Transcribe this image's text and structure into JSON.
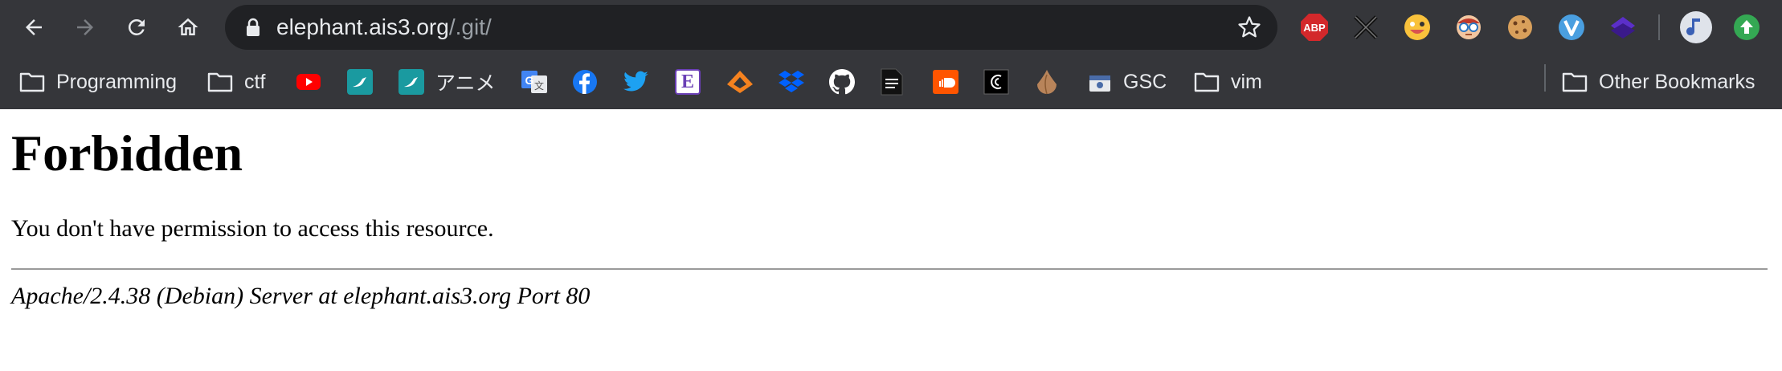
{
  "browser": {
    "url_host": "elephant.ais3.org",
    "url_path": "/.git/",
    "extensions": [
      {
        "icon": "adblock-plus-icon",
        "label": "ABP",
        "color": "#d3282b"
      },
      {
        "icon": "crossed-tools-icon"
      },
      {
        "icon": "grinning-emoji-icon"
      },
      {
        "icon": "glasses-face-icon"
      },
      {
        "icon": "cookie-icon"
      },
      {
        "icon": "vimium-icon",
        "color": "#4a9fe0"
      },
      {
        "icon": "purple-layers-icon",
        "color": "#5b2fc9"
      },
      {
        "icon": "profile-avatar-icon"
      },
      {
        "icon": "update-arrow-icon",
        "color": "#34a853"
      }
    ]
  },
  "bookmarks": {
    "items": [
      {
        "label": "Programming",
        "icon": "folder-icon"
      },
      {
        "label": "ctf",
        "icon": "folder-icon"
      },
      {
        "label": "",
        "icon": "youtube-icon",
        "color": "#ff0000"
      },
      {
        "label": "",
        "icon": "teal-bird-icon",
        "color": "#1a9aa0"
      },
      {
        "label": "アニメ",
        "icon": "teal-bird-icon",
        "color": "#1a9aa0"
      },
      {
        "label": "",
        "icon": "google-translate-icon",
        "color": "#4285f4"
      },
      {
        "label": "",
        "icon": "facebook-icon",
        "color": "#1877f2"
      },
      {
        "label": "",
        "icon": "twitter-icon",
        "color": "#1da1f2"
      },
      {
        "label": "",
        "icon": "e-book-icon",
        "color": "#6a3fb5"
      },
      {
        "label": "",
        "icon": "orange-diamond-icon",
        "color": "#f5821f"
      },
      {
        "label": "",
        "icon": "dropbox-icon",
        "color": "#0061ff"
      },
      {
        "label": "",
        "icon": "github-icon"
      },
      {
        "label": "",
        "icon": "document-icon"
      },
      {
        "label": "",
        "icon": "soundcloud-icon",
        "color": "#ff5500"
      },
      {
        "label": "",
        "icon": "swirl-icon"
      },
      {
        "label": "",
        "icon": "onion-icon",
        "color": "#b8845a"
      },
      {
        "label": "GSC",
        "icon": "gsc-icon"
      },
      {
        "label": "vim",
        "icon": "folder-icon"
      }
    ],
    "other": "Other Bookmarks"
  },
  "page": {
    "title": "Forbidden",
    "message": "You don't have permission to access this resource.",
    "server_signature": "Apache/2.4.38 (Debian) Server at elephant.ais3.org Port 80"
  }
}
